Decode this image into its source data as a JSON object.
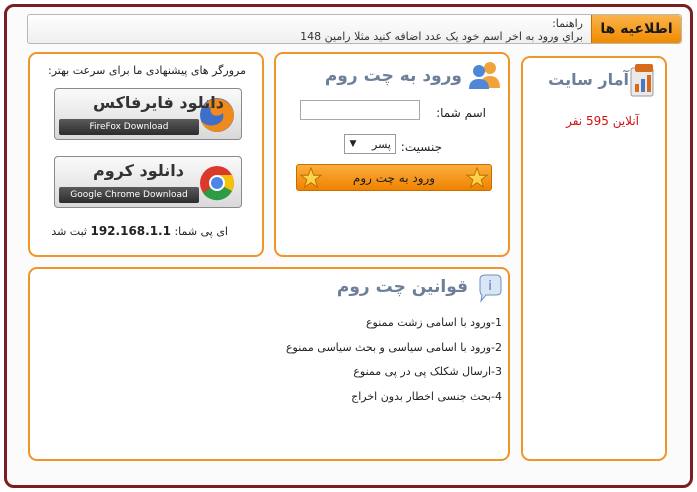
{
  "notice": {
    "tab": "اطلاعیه ها",
    "label": "راهنما:",
    "text": "براي ورود به اخر اسم خود يک عدد اضافه کنيد مثلا رامين 148"
  },
  "stats": {
    "title": "آمار سایت",
    "online": "آنلاین 595 نفر"
  },
  "login": {
    "title": "ورود به چت روم",
    "name_label": "اسم شما:",
    "name_value": "",
    "gender_label": "جنسیت:",
    "gender_value": "پسر",
    "enter_button": "ورود به چت روم"
  },
  "browsers": {
    "hint": "مرورگر های پیشنهادی ما برای سرعت بهتر:",
    "firefox_title": "دانلود فایرفاکس",
    "firefox_sub": "FireFox Download",
    "chrome_title": "دانلود کروم",
    "chrome_sub": "Google Chrome Download",
    "ip_prefix": "ای پی شما:",
    "ip_value": "192.168.1.1",
    "ip_suffix": "ثبت شد"
  },
  "rules": {
    "title": "قوانین چت روم",
    "items": [
      "1-ورود با اسامی زشت ممنوع",
      "2-ورود با اسامی سیاسی و بحث سیاسی ممنوع",
      "3-ارسال شکلک پی در پی ممنوع",
      "4-بحث جنسی اخطار بدون اخراج"
    ]
  },
  "colors": {
    "frame": "#7a1f1f",
    "panel_border": "#f0952a",
    "accent_orange": "#f08a00",
    "title_gray_blue": "#6d7f99",
    "online_red": "#d01010"
  }
}
